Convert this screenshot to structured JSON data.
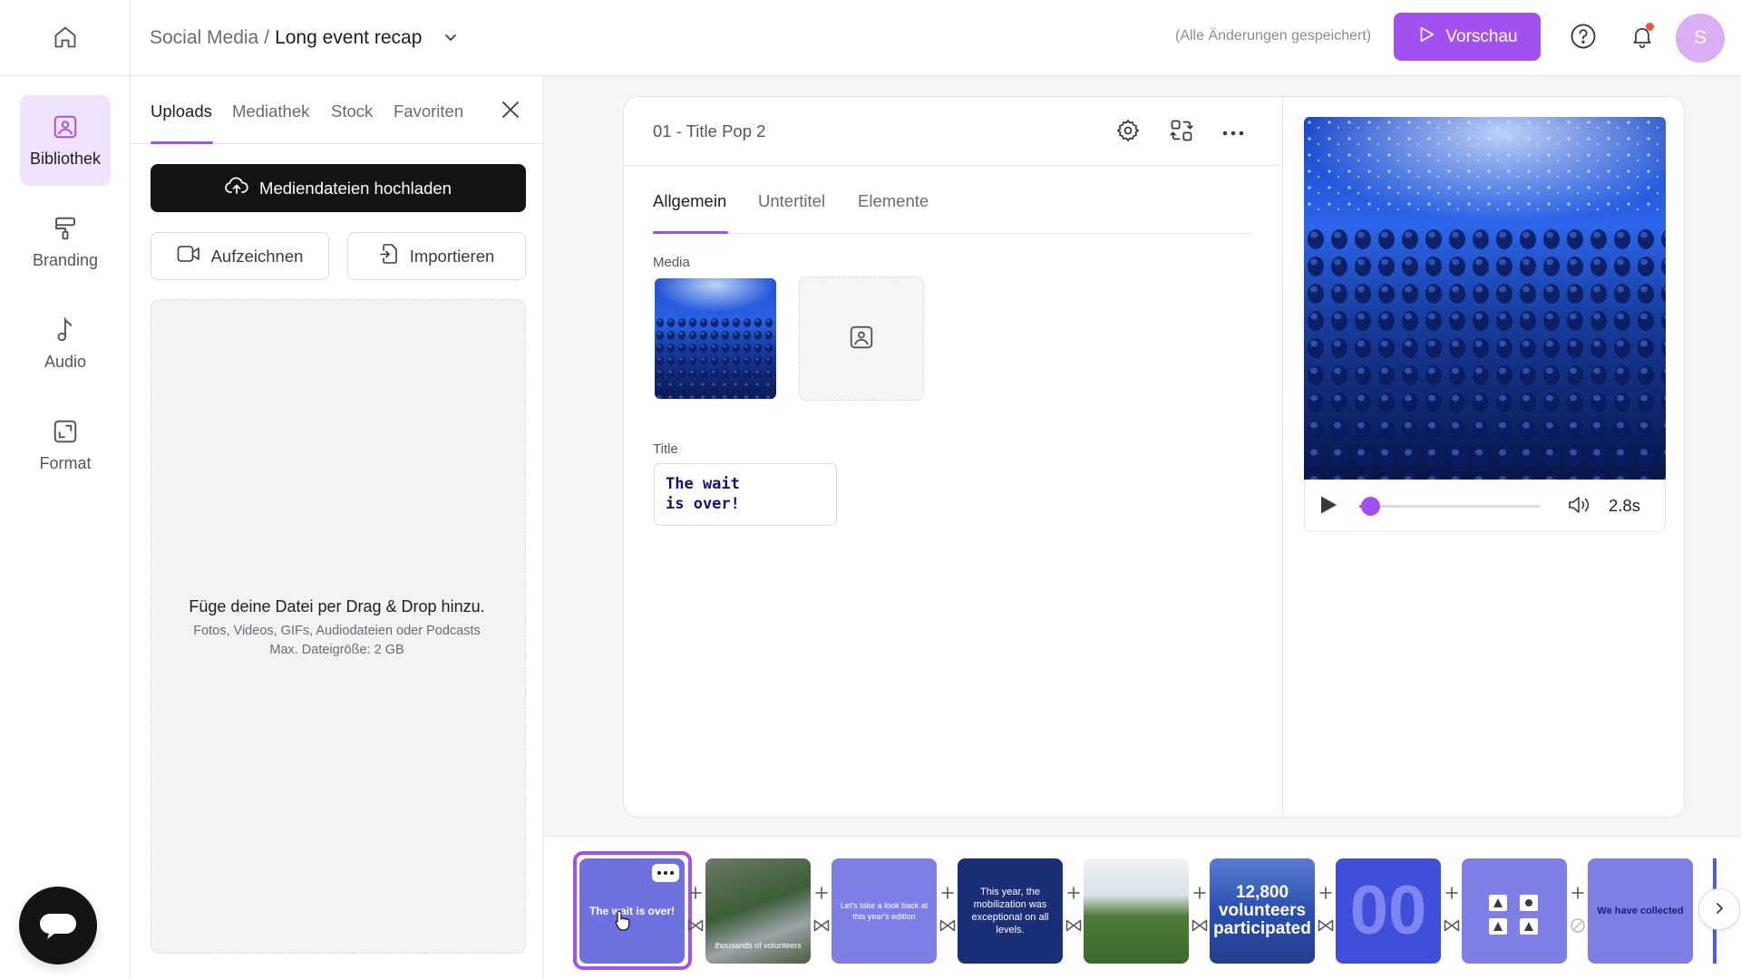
{
  "header": {
    "breadcrumb_parent": "Social Media",
    "breadcrumb_separator": "/",
    "breadcrumb_current": "Long event recap",
    "save_status": "(Alle Änderungen gespeichert)",
    "preview_label": "Vorschau",
    "avatar_initial": "S"
  },
  "leftnav": {
    "items": [
      {
        "label": "Bibliothek",
        "icon": "image-icon",
        "active": true
      },
      {
        "label": "Branding",
        "icon": "paint-roller-icon",
        "active": false
      },
      {
        "label": "Audio",
        "icon": "music-note-icon",
        "active": false
      },
      {
        "label": "Format",
        "icon": "resize-icon",
        "active": false
      }
    ]
  },
  "library": {
    "tabs": [
      "Uploads",
      "Mediathek",
      "Stock",
      "Favoriten"
    ],
    "active_tab": "Uploads",
    "upload_label": "Mediendateien hochladen",
    "record_label": "Aufzeichnen",
    "import_label": "Importieren",
    "dropzone_title": "Füge deine Datei per Drag & Drop hinzu.",
    "dropzone_sub": "Fotos, Videos, GIFs, Audiodateien oder Podcasts",
    "dropzone_max": "Max. Dateigröße: 2 GB"
  },
  "editor": {
    "scene_title": "01 - Title Pop 2",
    "tabs": [
      "Allgemein",
      "Untertitel",
      "Elemente"
    ],
    "active_tab": "Allgemein",
    "media_label": "Media",
    "title_label": "Title",
    "title_value": "The wait\nis over!"
  },
  "player": {
    "time": "2.8s",
    "progress_fraction": 0.02
  },
  "timeline": {
    "clips": [
      {
        "text": "The wait is over!",
        "selected": true
      },
      {
        "text": "thousands of volunteers"
      },
      {
        "text": "Let's take a look back at this year's edition"
      },
      {
        "text": "This year, the mobilization was exceptional on all levels."
      },
      {
        "text": ""
      },
      {
        "text": "12,800 volunteers participated"
      },
      {
        "text": "00"
      },
      {
        "text": ""
      },
      {
        "text": "We have collected"
      }
    ]
  },
  "colors": {
    "accent": "#a251f0",
    "dark": "#141416",
    "clip_purple": "#7d7fe6",
    "clip_dark_blue": "#1b2f78"
  }
}
